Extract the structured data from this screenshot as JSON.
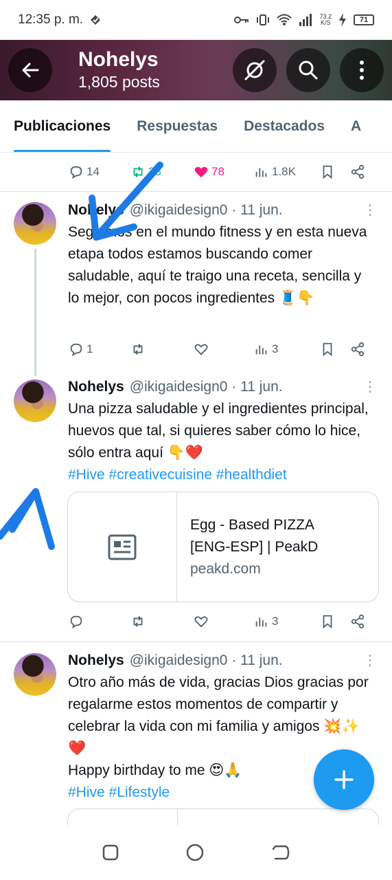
{
  "status_bar": {
    "time": "12:35 p. m.",
    "net_speed_value": "73.2",
    "net_speed_unit": "K/S",
    "battery": "71"
  },
  "header": {
    "name": "Nohelys",
    "posts": "1,805 posts"
  },
  "tabs": [
    {
      "label": "Publicaciones",
      "active": true
    },
    {
      "label": "Respuestas",
      "active": false
    },
    {
      "label": "Destacados",
      "active": false
    },
    {
      "label": "A",
      "active": false
    }
  ],
  "top_actions": {
    "replies": "14",
    "reposts": "23",
    "likes": "78",
    "views": "1.8K"
  },
  "tweets": [
    {
      "name": "Nohelys",
      "handle_time": "@ikigaidesign0 · 11 jun.",
      "text": "Seguimos en el mundo fitness y en esta nueva etapa todos estamos buscando comer saludable, aquí te traigo una receta, sencilla y lo mejor, con pocos ingredientes 🧵👇",
      "replies": "1",
      "views": "3"
    },
    {
      "name": "Nohelys",
      "handle_time": "@ikigaidesign0 · 11 jun.",
      "text": "Una pizza saludable y el ingredientes principal, huevos que tal, si quieres saber cómo lo hice, sólo entra aquí 👇❤️",
      "tags": "#Hive #creativecuisine #healthdiet",
      "card": {
        "title": "Egg - Based PIZZA [ENG-ESP] | PeakD",
        "domain": "peakd.com"
      },
      "views": "3"
    },
    {
      "name": "Nohelys",
      "handle_time": "@ikigaidesign0 · 11 jun.",
      "text": "Otro año más de vida, gracias Dios gracias por regalarme estos momentos de compartir y celebrar la vida con mi familia y amigos 💥✨❤️",
      "text2": "Happy birthday to me 😍🙏",
      "tags": "#Hive #Lifestyle"
    }
  ],
  "colors": {
    "accent": "#1d9bf0",
    "like": "#f91880",
    "repost": "#00ba7c",
    "annotation": "#1e7be6"
  }
}
